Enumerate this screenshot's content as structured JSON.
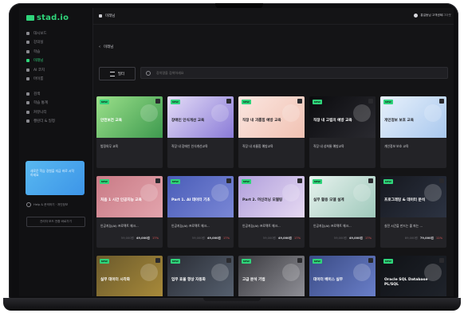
{
  "app": {
    "logo": "stad.io",
    "brand_color": "#2fd47a"
  },
  "sidebar": {
    "items": [
      {
        "label": "대시보드",
        "icon": "dashboard-icon",
        "active": false
      },
      {
        "label": "강의실",
        "icon": "classroom-icon",
        "active": false
      },
      {
        "label": "학습",
        "icon": "study-icon",
        "active": false
      },
      {
        "label": "미래님",
        "icon": "library-icon",
        "active": true
      },
      {
        "label": "AI 코치",
        "icon": "ai-icon",
        "active": false
      },
      {
        "label": "마이룸",
        "icon": "user-icon",
        "active": false
      },
      {
        "label": "검색",
        "icon": "search-icon",
        "active": false
      },
      {
        "label": "학습 통계",
        "icon": "stats-icon",
        "active": false
      },
      {
        "label": "커뮤니티",
        "icon": "community-icon",
        "active": false
      },
      {
        "label": "캘린더 & 일정",
        "icon": "calendar-icon",
        "active": false
      }
    ],
    "promo_text": "새로운 학습 경험을 지금 바로 시작하세요",
    "radio_label": "Help & 문의하기 · 개인정보",
    "bottom_button": "관리자 모드 전환 바로가기"
  },
  "topbar": {
    "title": "미래님",
    "user_name": "홍길동님 고객센터",
    "right_text": "로그아웃"
  },
  "nav": {
    "back_label": "미래님"
  },
  "filters": {
    "filter_label": "필터",
    "search_placeholder": "강의명을 검색하세요"
  },
  "courses": [
    {
      "thumb_text": "안전보건 교육",
      "title": "법정의무 교육",
      "price_old": "",
      "price_new": "",
      "discount": ""
    },
    {
      "thumb_text": "장애인 인식개선 교육",
      "title": "직장 내 장애인 인식개선교육",
      "price_old": "",
      "price_new": "",
      "discount": ""
    },
    {
      "thumb_text": "직장 내 괴롭힘 예방 교육",
      "title": "직장 내 괴롭힘 예방교육",
      "price_old": "",
      "price_new": "",
      "discount": ""
    },
    {
      "thumb_text": "직장 내 고립의 예방 교육",
      "title": "직장 내 성희롱 예방교육",
      "price_old": "",
      "price_new": "",
      "discount": ""
    },
    {
      "thumb_text": "개인정보 보호 교육",
      "title": "개인정보 보호 교육",
      "price_old": "",
      "price_new": "",
      "discount": ""
    },
    {
      "thumb_text": "처음 1 시간 인공지능 교육",
      "title": "인공지능(AI) 프로젝트 체크...",
      "price_old": "59,000원",
      "price_new": "49,000원",
      "discount": "17%"
    },
    {
      "thumb_text": "Part 1. AI 데이터 기초",
      "title": "인공지능(AI) 프로젝트 체크...",
      "price_old": "59,000원",
      "price_new": "49,000원",
      "discount": "17%"
    },
    {
      "thumb_text": "Part 2. 머신러닝 모델링",
      "title": "인공지능(AI) 프로젝트 체크...",
      "price_old": "59,000원",
      "price_new": "49,000원",
      "discount": "17%"
    },
    {
      "thumb_text": "실무 활용 모델 설계",
      "title": "인공지능(AI) 프로젝트 체크...",
      "price_old": "59,000원",
      "price_new": "49,000원",
      "discount": "17%"
    },
    {
      "thumb_text": "프로그래밍 & 데이터 분석",
      "title": "실전 시간을 만드는 줄 파는 ...",
      "price_old": "89,000원",
      "price_new": "79,000원",
      "discount": "11%"
    },
    {
      "thumb_text": "실무 데이터 시각화",
      "title": "",
      "price_old": "",
      "price_new": "",
      "discount": ""
    },
    {
      "thumb_text": "업무 효율 향상 자동화",
      "title": "",
      "price_old": "",
      "price_new": "",
      "discount": ""
    },
    {
      "thumb_text": "고급 분석 기법",
      "title": "",
      "price_old": "",
      "price_new": "",
      "discount": ""
    },
    {
      "thumb_text": "데이터 베이스 실무",
      "title": "",
      "price_old": "",
      "price_new": "",
      "discount": ""
    },
    {
      "thumb_text": "Oracle SQL Database PL/SQL",
      "title": "",
      "price_old": "",
      "price_new": "",
      "discount": ""
    }
  ],
  "thumb_colors": [
    [
      "#9be08a",
      "#3e9a4f"
    ],
    [
      "#e4dcf6",
      "#8a7bd8"
    ],
    [
      "#fbe6e0",
      "#f1c2b3"
    ],
    [
      "#0b0b0e",
      "#2a2a30"
    ],
    [
      "#e8f1fb",
      "#a9c8ee"
    ],
    [
      "#c97b86",
      "#e3a4ad"
    ],
    [
      "#4a5db8",
      "#7a87d6"
    ],
    [
      "#b1a0dc",
      "#e6d9f2"
    ],
    [
      "#e7f2ee",
      "#9fc9bb"
    ],
    [
      "#16181f",
      "#2c3342"
    ],
    [
      "#6b5a2c",
      "#a88a3a"
    ],
    [
      "#2a2d35",
      "#56606f"
    ],
    [
      "#3b3b40",
      "#8f8f96"
    ],
    [
      "#3a4b85",
      "#6a7fc9"
    ],
    [
      "#101216",
      "#1f232b"
    ]
  ]
}
